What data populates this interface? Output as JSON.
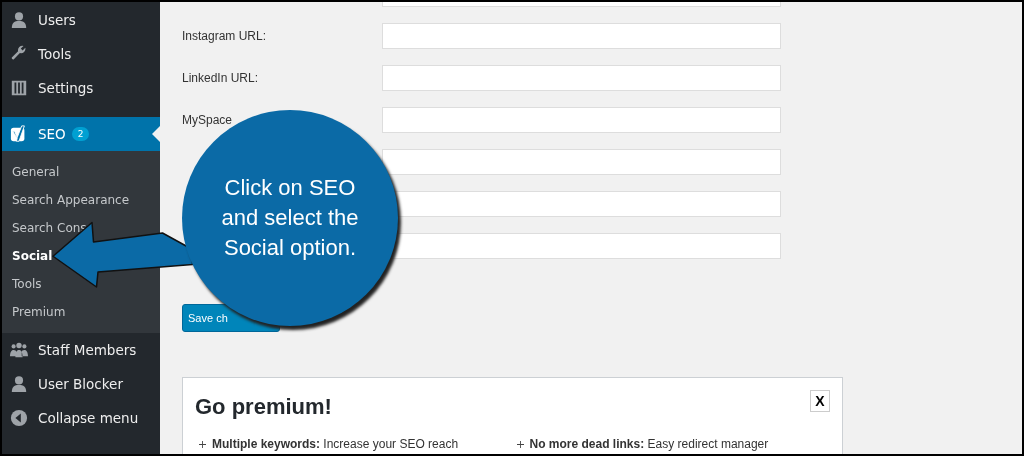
{
  "sidebar": {
    "items": [
      {
        "label": "Users",
        "kind": "user",
        "selected": false
      },
      {
        "label": "Tools",
        "kind": "wrench",
        "selected": false
      },
      {
        "label": "Settings",
        "kind": "sliders",
        "selected": false
      },
      {
        "label": "SEO",
        "kind": "logo",
        "badge": "2",
        "selected": true,
        "children": [
          {
            "label": "General",
            "selected": false
          },
          {
            "label": "Search Appearance",
            "selected": false
          },
          {
            "label": "Search Cons",
            "selected": false
          },
          {
            "label": "Social",
            "selected": true
          },
          {
            "label": "Tools",
            "selected": false
          },
          {
            "label": "Premium",
            "selected": false
          }
        ]
      },
      {
        "label": "Staff Members",
        "kind": "group",
        "selected": false
      },
      {
        "label": "User Blocker",
        "kind": "user",
        "selected": false
      },
      {
        "label": "Collapse menu",
        "kind": "collapse",
        "selected": false
      }
    ]
  },
  "form": {
    "fields": [
      {
        "kind": "url"
      },
      {
        "kind": "url",
        "label": "Instagram URL:"
      },
      {
        "kind": "url",
        "label": "LinkedIn URL:"
      },
      {
        "kind": "url",
        "label": "MySpace"
      },
      {
        "kind": "url"
      },
      {
        "kind": "url"
      },
      {
        "kind": "url"
      }
    ],
    "save_button": "Save ch"
  },
  "callout": {
    "text": "Click on SEO and select the Social option."
  },
  "premium_box": {
    "title": "Go premium!",
    "close": "X",
    "features": [
      "**Multiple keywords:** Increase your SEO reach",
      "**No more dead links:** Easy redirect manager"
    ]
  }
}
